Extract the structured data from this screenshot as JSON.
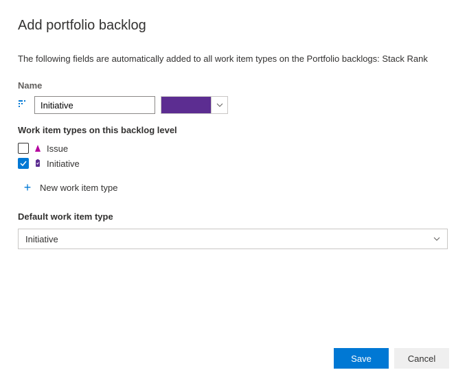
{
  "title": "Add portfolio backlog",
  "description": "The following fields are automatically added to all work item types on the Portfolio backlogs: Stack Rank",
  "name": {
    "label": "Name",
    "value": "Initiative",
    "color": "#5c2d91"
  },
  "workItemTypes": {
    "label": "Work item types on this backlog level",
    "items": [
      {
        "label": "Issue",
        "checked": false,
        "iconColor": "#b4009e"
      },
      {
        "label": "Initiative",
        "checked": true,
        "iconColor": "#5c2d91"
      }
    ],
    "addLabel": "New work item type"
  },
  "defaultType": {
    "label": "Default work item type",
    "value": "Initiative"
  },
  "buttons": {
    "save": "Save",
    "cancel": "Cancel"
  }
}
